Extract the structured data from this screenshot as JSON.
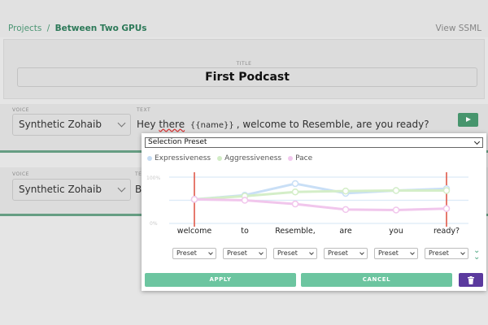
{
  "breadcrumb": {
    "root": "Projects",
    "separator": "/",
    "current": "Between Two GPUs"
  },
  "header": {
    "view_ssml": "View SSML"
  },
  "title_card": {
    "label": "TITLE",
    "value": "First Podcast"
  },
  "clips": [
    {
      "voice_label": "VOICE",
      "voice_value": "Synthetic Zohaib",
      "text_label": "TEXT",
      "text_before": "Hey ",
      "text_underlined": "there",
      "text_variable": "{{name}}",
      "text_after": ", welcome to Resemble, are you ready?"
    },
    {
      "voice_label": "VOICE",
      "voice_value": "Synthetic Zohaib",
      "text_label": "TE",
      "text_fragment": "B"
    }
  ],
  "overlay": {
    "preset_selector": "Selection Preset",
    "legend": [
      {
        "name": "Expressiveness",
        "color": "#c6dcf3"
      },
      {
        "name": "Aggressiveness",
        "color": "#d2ecc6"
      },
      {
        "name": "Pace",
        "color": "#f2c8ee"
      }
    ],
    "y_ticks": [
      "100%",
      "0%"
    ],
    "words": [
      "welcome",
      "to",
      "Resemble,",
      "are",
      "you",
      "ready?"
    ],
    "preset_dropdowns": [
      "Preset",
      "Preset",
      "Preset",
      "Preset",
      "Preset",
      "Preset"
    ],
    "apply_label": "APPLY",
    "cancel_label": "CANCEL"
  },
  "chart_data": {
    "type": "line",
    "categories": [
      "welcome",
      "to",
      "Resemble,",
      "are",
      "you",
      "ready?"
    ],
    "series": [
      {
        "name": "Expressiveness",
        "color": "#c6dcf3",
        "values": [
          0.52,
          0.61,
          0.86,
          0.65,
          0.71,
          0.75
        ]
      },
      {
        "name": "Aggressiveness",
        "color": "#d2ecc6",
        "values": [
          0.52,
          0.59,
          0.68,
          0.7,
          0.71,
          0.71
        ]
      },
      {
        "name": "Pace",
        "color": "#f2c8ee",
        "values": [
          0.52,
          0.5,
          0.42,
          0.3,
          0.29,
          0.32
        ]
      }
    ],
    "ylim": [
      0,
      1
    ],
    "y_tick_labels": [
      "100%",
      "0%"
    ],
    "grid": true,
    "legend_position": "top-left",
    "colors": {
      "marker_line": "#e05a4a",
      "apply": "#6cc5a0",
      "delete": "#5b3a9e",
      "brand": "#4a9a71"
    }
  }
}
